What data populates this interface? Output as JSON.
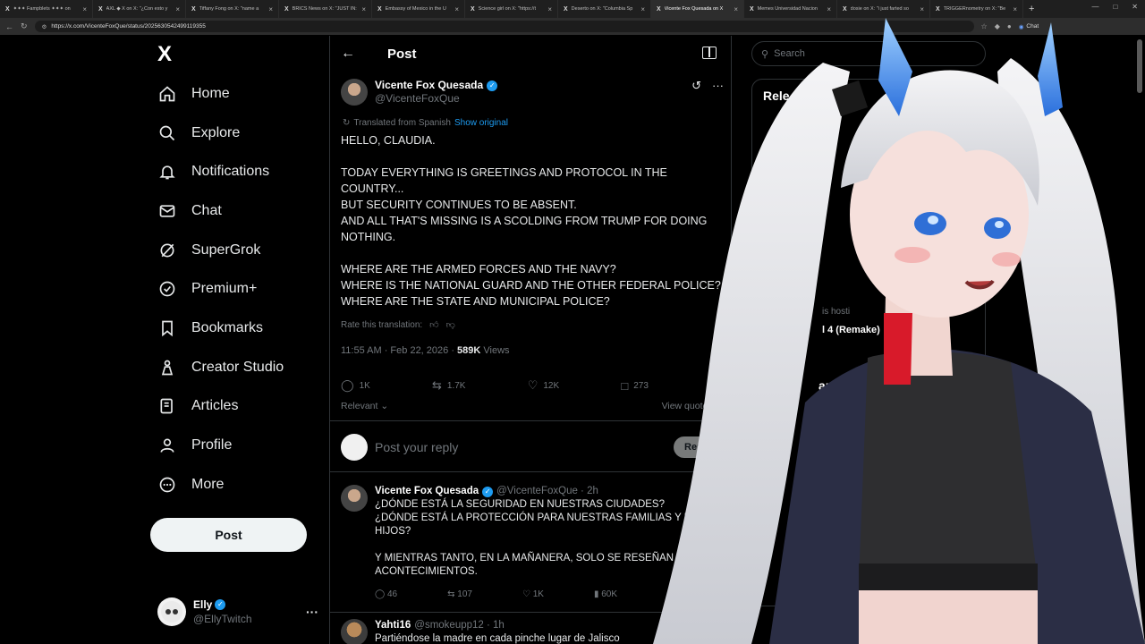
{
  "browser": {
    "tabs": [
      {
        "title": "✦✦✦ Fampblets ✦✦✦ on",
        "active": false
      },
      {
        "title": "AXL ◆ X on X: \"¿Con esto y",
        "active": false
      },
      {
        "title": "Tiffany Fong on X: \"name a",
        "active": false
      },
      {
        "title": "BRICS News on X: \"JUST IN:",
        "active": false
      },
      {
        "title": "Embassy of Mexico in the U",
        "active": false
      },
      {
        "title": "Science girl on X: \"https://t",
        "active": false
      },
      {
        "title": "Deserto on X: \"Columbia Sp",
        "active": false
      },
      {
        "title": "Vicente Fox Quesada on X",
        "active": true
      },
      {
        "title": "Memes Universidad Nacion",
        "active": false
      },
      {
        "title": "dosie on X: \"i just farted so",
        "active": false
      },
      {
        "title": "TRIGGERnometry on X: \"Be",
        "active": false
      }
    ],
    "url": "https://x.com/VicenteFoxQue/status/2025630542499119355",
    "chat_label": "Chat"
  },
  "sidebar": {
    "logo": "X",
    "items": [
      {
        "label": "Home",
        "icon": "home-icon"
      },
      {
        "label": "Explore",
        "icon": "search-icon"
      },
      {
        "label": "Notifications",
        "icon": "bell-icon"
      },
      {
        "label": "Chat",
        "icon": "mail-icon"
      },
      {
        "label": "SuperGrok",
        "icon": "grok-icon"
      },
      {
        "label": "Premium+",
        "icon": "verified-icon"
      },
      {
        "label": "Bookmarks",
        "icon": "bookmark-icon"
      },
      {
        "label": "Creator Studio",
        "icon": "creator-icon"
      },
      {
        "label": "Articles",
        "icon": "articles-icon"
      },
      {
        "label": "Profile",
        "icon": "person-icon"
      },
      {
        "label": "More",
        "icon": "more-circle-icon"
      }
    ],
    "post_label": "Post",
    "account": {
      "name": "Elly",
      "handle": "@EllyTwitch",
      "more": "···"
    }
  },
  "main": {
    "header_title": "Post",
    "author": {
      "name": "Vicente Fox Quesada",
      "handle": "@VicenteFoxQue"
    },
    "translated_label": "Translated from Spanish",
    "show_original": "Show original",
    "text_lines": [
      "HELLO, CLAUDIA.",
      "",
      "TODAY EVERYTHING IS GREETINGS AND PROTOCOL IN THE",
      "COUNTRY...",
      "BUT SECURITY CONTINUES TO BE ABSENT.",
      "AND ALL THAT'S MISSING IS A SCOLDING FROM TRUMP FOR DOING",
      "NOTHING.",
      "",
      "WHERE ARE THE ARMED FORCES AND THE NAVY?",
      "WHERE IS THE NATIONAL GUARD AND THE OTHER FEDERAL POLICE?",
      "WHERE ARE THE STATE AND MUNICIPAL POLICE?"
    ],
    "rate_label": "Rate this translation:",
    "timestamp": "11:55 AM · Feb 22, 2026 ·",
    "views_count": "589K",
    "views_label": "Views",
    "stats": {
      "replies": "1K",
      "reposts": "1.7K",
      "likes": "12K",
      "bookmarks": "273"
    },
    "relevant_label": "Relevant",
    "view_quotes_label": "View quotes",
    "reply_placeholder": "Post your reply",
    "reply_button": "Reply",
    "replies": [
      {
        "name": "Vicente Fox Quesada",
        "handle": "@VicenteFoxQue · 2h",
        "lines": [
          "¿DÓNDE ESTÁ LA SEGURIDAD EN NUESTRAS CIUDADES?",
          "¿DÓNDE ESTÁ LA PROTECCIÓN PARA NUESTRAS FAMILIAS Y NUES",
          "HIJOS?",
          "",
          "Y MIENTRAS TANTO, EN LA MAÑANERA, SOLO SE RESEÑAN LOS",
          "ACONTECIMIENTOS."
        ],
        "stats": {
          "replies": "46",
          "reposts": "107",
          "likes": "1K",
          "views": "60K"
        }
      },
      {
        "name": "Yahti16",
        "handle": "@smokeupp12 · 1h",
        "lines": [
          "Partiéndose la madre en cada pinche lugar de Jalisco"
        ]
      }
    ]
  },
  "right": {
    "search_placeholder": "Search",
    "relevant_title": "Rele",
    "hosting_text": "is hosti",
    "remake_text": "l 4 (Remake)",
    "happening_title": "appening"
  }
}
